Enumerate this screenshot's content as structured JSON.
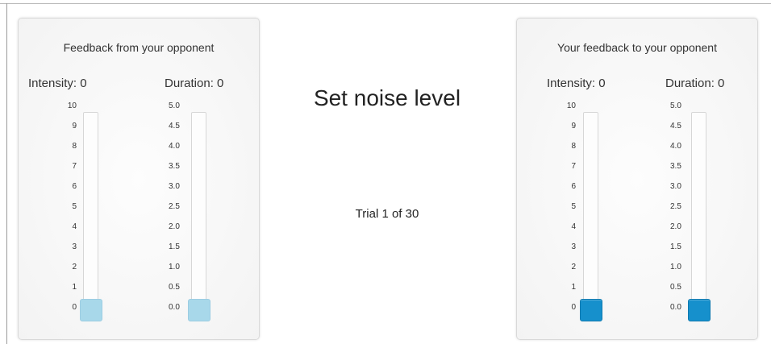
{
  "left_panel": {
    "title": "Feedback from your opponent",
    "intensity": {
      "label": "Intensity:",
      "value": "0",
      "ticks": [
        "10",
        "9",
        "8",
        "7",
        "6",
        "5",
        "4",
        "3",
        "2",
        "1",
        "0"
      ],
      "level": 0
    },
    "duration": {
      "label": "Duration:",
      "value": "0",
      "ticks": [
        "5.0",
        "4.5",
        "4.0",
        "3.5",
        "3.0",
        "2.5",
        "2.0",
        "1.5",
        "1.0",
        "0.5",
        "0.0"
      ],
      "level": 0
    }
  },
  "right_panel": {
    "title": "Your feedback to your opponent",
    "intensity": {
      "label": "Intensity:",
      "value": "0",
      "ticks": [
        "10",
        "9",
        "8",
        "7",
        "6",
        "5",
        "4",
        "3",
        "2",
        "1",
        "0"
      ],
      "level": 0
    },
    "duration": {
      "label": "Duration:",
      "value": "0",
      "ticks": [
        "5.0",
        "4.5",
        "4.0",
        "3.5",
        "3.0",
        "2.5",
        "2.0",
        "1.5",
        "1.0",
        "0.5",
        "0.0"
      ],
      "level": 0
    }
  },
  "center": {
    "title": "Set noise level",
    "trial": "Trial 1 of 30"
  },
  "colors": {
    "handle_passive": "#a8d8ea",
    "handle_active": "#1690cc"
  }
}
